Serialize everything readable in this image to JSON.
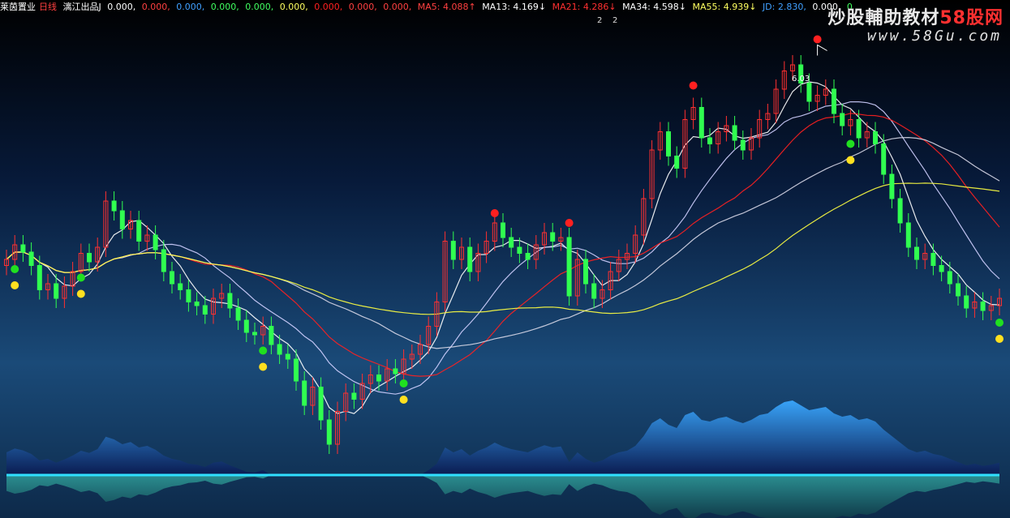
{
  "header": {
    "stock_name": "莱茵置业",
    "period": "日线",
    "indicator": "漓江出品J",
    "values": [
      "0.000,",
      "0.000,",
      "0.000,",
      "0.000,",
      "0.000,",
      "0.000,",
      "0.000,",
      "0.000,",
      "0.000,"
    ],
    "ma5": "MA5: 4.088↑",
    "ma13": "MA13: 4.169↓",
    "ma21": "MA21: 4.286↓",
    "ma34": "MA34: 4.598↓",
    "ma55": "MA55: 4.939↓",
    "jd": "JD: 2.830,",
    "tail": [
      "0.000,",
      "0"
    ],
    "sub_marks": [
      "2",
      "2"
    ]
  },
  "watermark": {
    "line1": "炒股輔助教材",
    "line1_red": "58股网",
    "line2": "www.58Gu.com"
  },
  "colors": {
    "background_top": "#000000",
    "background_bottom": "#1a4a78",
    "up": "#ff3030",
    "down": "#30ff50",
    "ma5": "#ffffff",
    "ma13": "#d0d0ff",
    "ma21": "#ff2020",
    "ma34": "#d8d8e8",
    "ma55": "#ffff40",
    "wave": "#3aa8ff"
  },
  "chart_data": {
    "type": "candlestick",
    "title": "莱茵置业 日线",
    "peak_label": "6.03",
    "ylim": [
      2.6,
      6.3
    ],
    "series": [
      {
        "name": "MA5",
        "last": 4.088
      },
      {
        "name": "MA13",
        "last": 4.169
      },
      {
        "name": "MA21",
        "last": 4.286
      },
      {
        "name": "MA34",
        "last": 4.598
      },
      {
        "name": "MA55",
        "last": 4.939
      }
    ],
    "closes": [
      4.3,
      4.42,
      4.36,
      4.25,
      4.05,
      4.1,
      3.98,
      4.08,
      4.2,
      4.35,
      4.28,
      4.4,
      4.78,
      4.7,
      4.55,
      4.62,
      4.45,
      4.5,
      4.38,
      4.2,
      4.1,
      4.05,
      3.95,
      3.92,
      3.85,
      3.98,
      4.02,
      3.9,
      3.8,
      3.7,
      3.68,
      3.75,
      3.6,
      3.52,
      3.48,
      3.3,
      3.1,
      3.25,
      2.98,
      2.78,
      3.05,
      3.2,
      3.15,
      3.28,
      3.35,
      3.3,
      3.4,
      3.36,
      3.48,
      3.52,
      3.6,
      3.75,
      3.95,
      4.45,
      4.3,
      4.4,
      4.2,
      4.35,
      4.45,
      4.6,
      4.48,
      4.4,
      4.35,
      4.3,
      4.42,
      4.52,
      4.45,
      4.48,
      4.0,
      4.3,
      4.1,
      3.98,
      4.05,
      4.2,
      4.3,
      4.35,
      4.5,
      4.8,
      5.2,
      5.35,
      5.15,
      5.05,
      5.45,
      5.55,
      5.3,
      5.25,
      5.35,
      5.4,
      5.28,
      5.2,
      5.3,
      5.45,
      5.5,
      5.7,
      5.85,
      5.9,
      5.75,
      5.6,
      5.65,
      5.7,
      5.5,
      5.4,
      5.45,
      5.3,
      5.35,
      5.25,
      5.0,
      4.8,
      4.6,
      4.4,
      4.3,
      4.35,
      4.25,
      4.2,
      4.1,
      4.0,
      3.9,
      3.95,
      3.88,
      3.92,
      3.98
    ],
    "signals": {
      "red_dots": [
        {
          "i": 68,
          "v": 4.52
        },
        {
          "i": 59,
          "v": 4.6
        },
        {
          "i": 83,
          "v": 5.65
        },
        {
          "i": 98,
          "v": 6.03
        }
      ],
      "green_yellow_pairs": [
        1,
        9,
        31,
        48,
        102,
        120
      ]
    }
  }
}
